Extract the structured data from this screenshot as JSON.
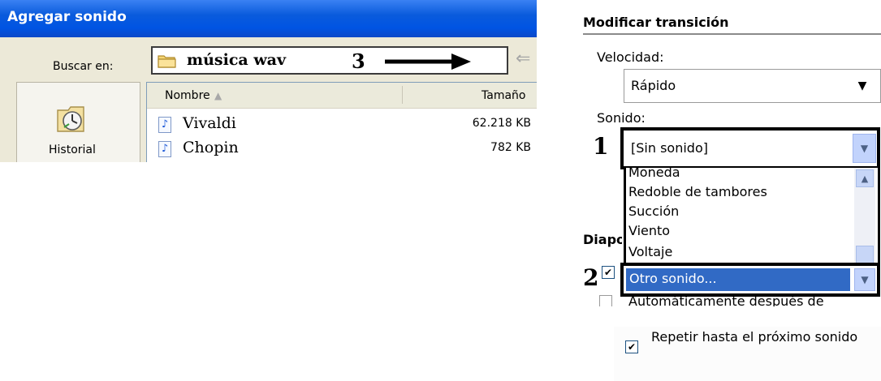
{
  "dialog": {
    "title": "Agregar sonido",
    "look_in_label": "Buscar en:",
    "folder_name": "música wav",
    "annotation": "3",
    "places": [
      {
        "label": "Historial",
        "icon": "history-clock-icon"
      }
    ],
    "columns": {
      "name": "Nombre",
      "size": "Tamaño"
    },
    "files": [
      {
        "name": "Vivaldi",
        "size": "62.218 KB"
      },
      {
        "name": "Chopin",
        "size": "782 KB"
      }
    ]
  },
  "pane": {
    "title": "Modificar transición",
    "speed_label": "Velocidad:",
    "speed_value": "Rápido",
    "sound_label": "Sonido:",
    "sound_value": "[Sin sonido]",
    "annotation_1": "1",
    "sound_options": [
      "Moneda",
      "Redoble de tambores",
      "Succión",
      "Viento",
      "Voltaje"
    ],
    "selected_option": "Otro sonido...",
    "annotation_2": "2",
    "slides_heading_partial": "Diapo",
    "auto_after_label": "Automáticamente después de",
    "loop_label": "Repetir hasta el próximo sonido"
  },
  "colors": {
    "title_bar": "#0054e3",
    "selection": "#316ac5",
    "dialog_bg": "#ece9d8"
  }
}
